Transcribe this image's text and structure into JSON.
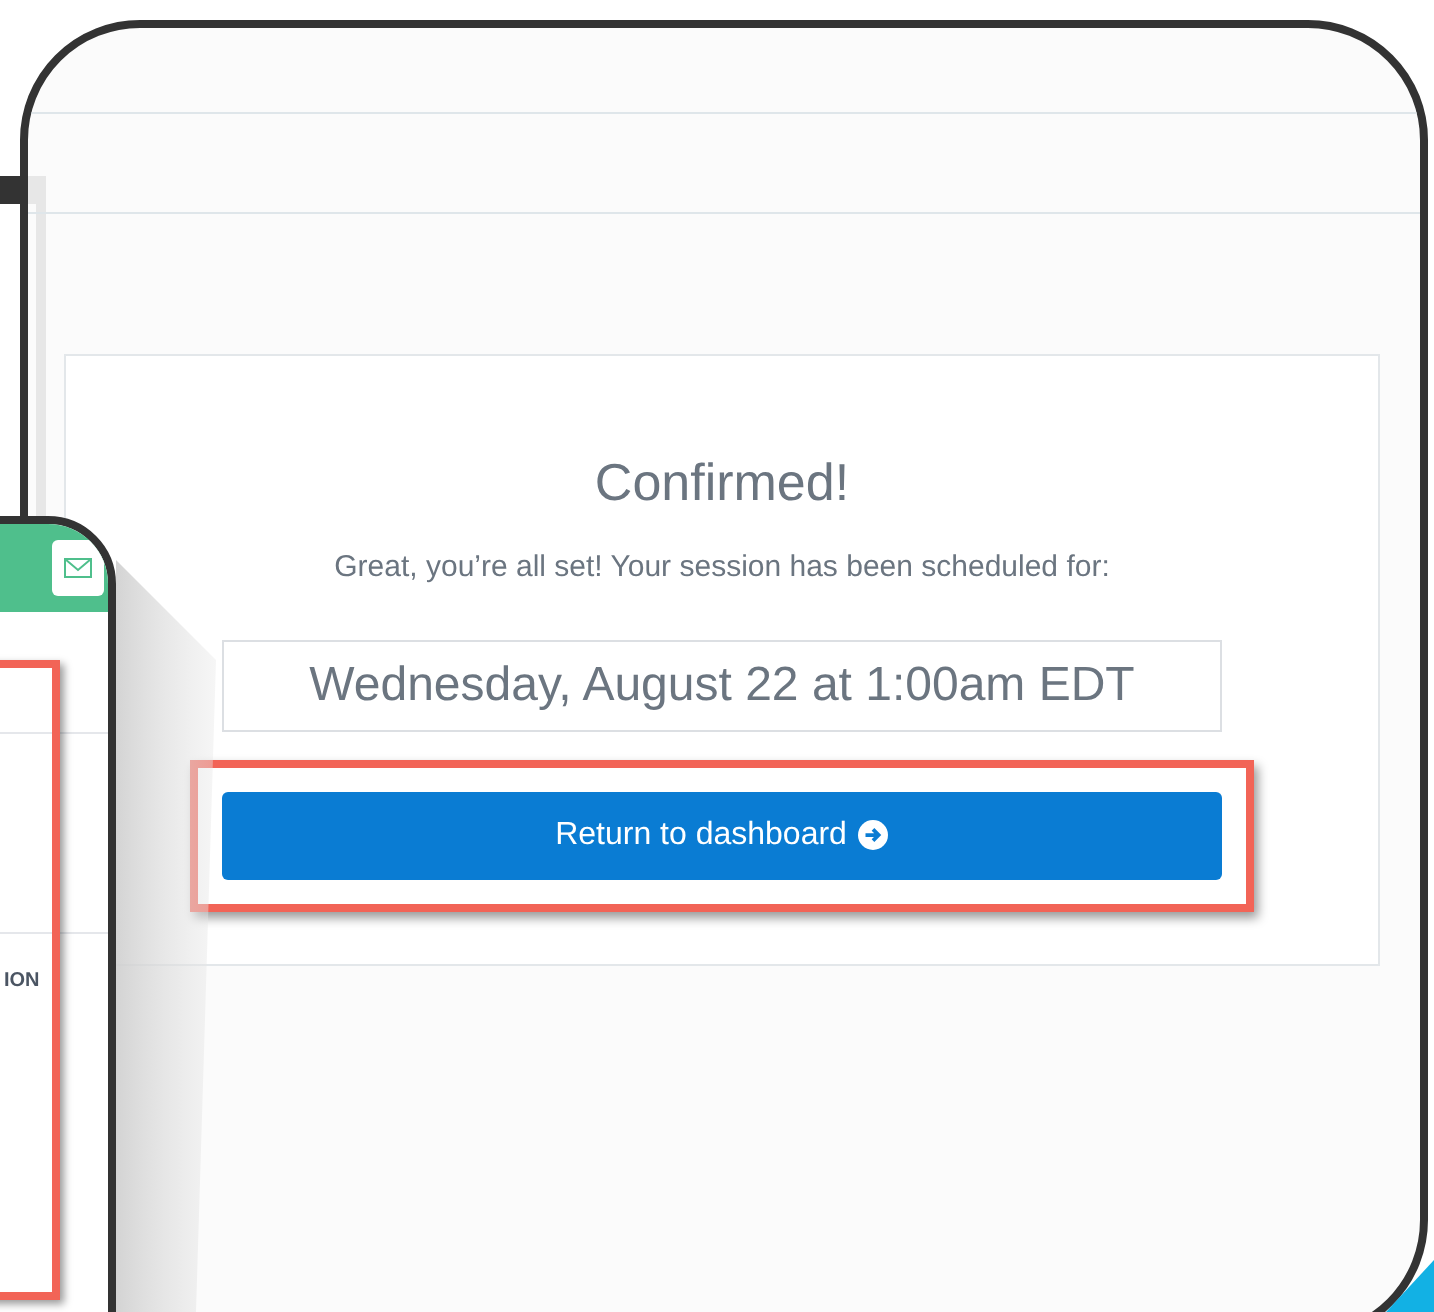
{
  "preview": {
    "column_heading_fragment": "ION"
  },
  "confirmation": {
    "title": "Confirmed!",
    "message": "Great, you’re all set! Your session has been scheduled for:",
    "scheduled_time": "Wednesday, August 22 at 1:00am EDT",
    "button": {
      "label": "Return to dashboard",
      "highlighted": true
    }
  }
}
